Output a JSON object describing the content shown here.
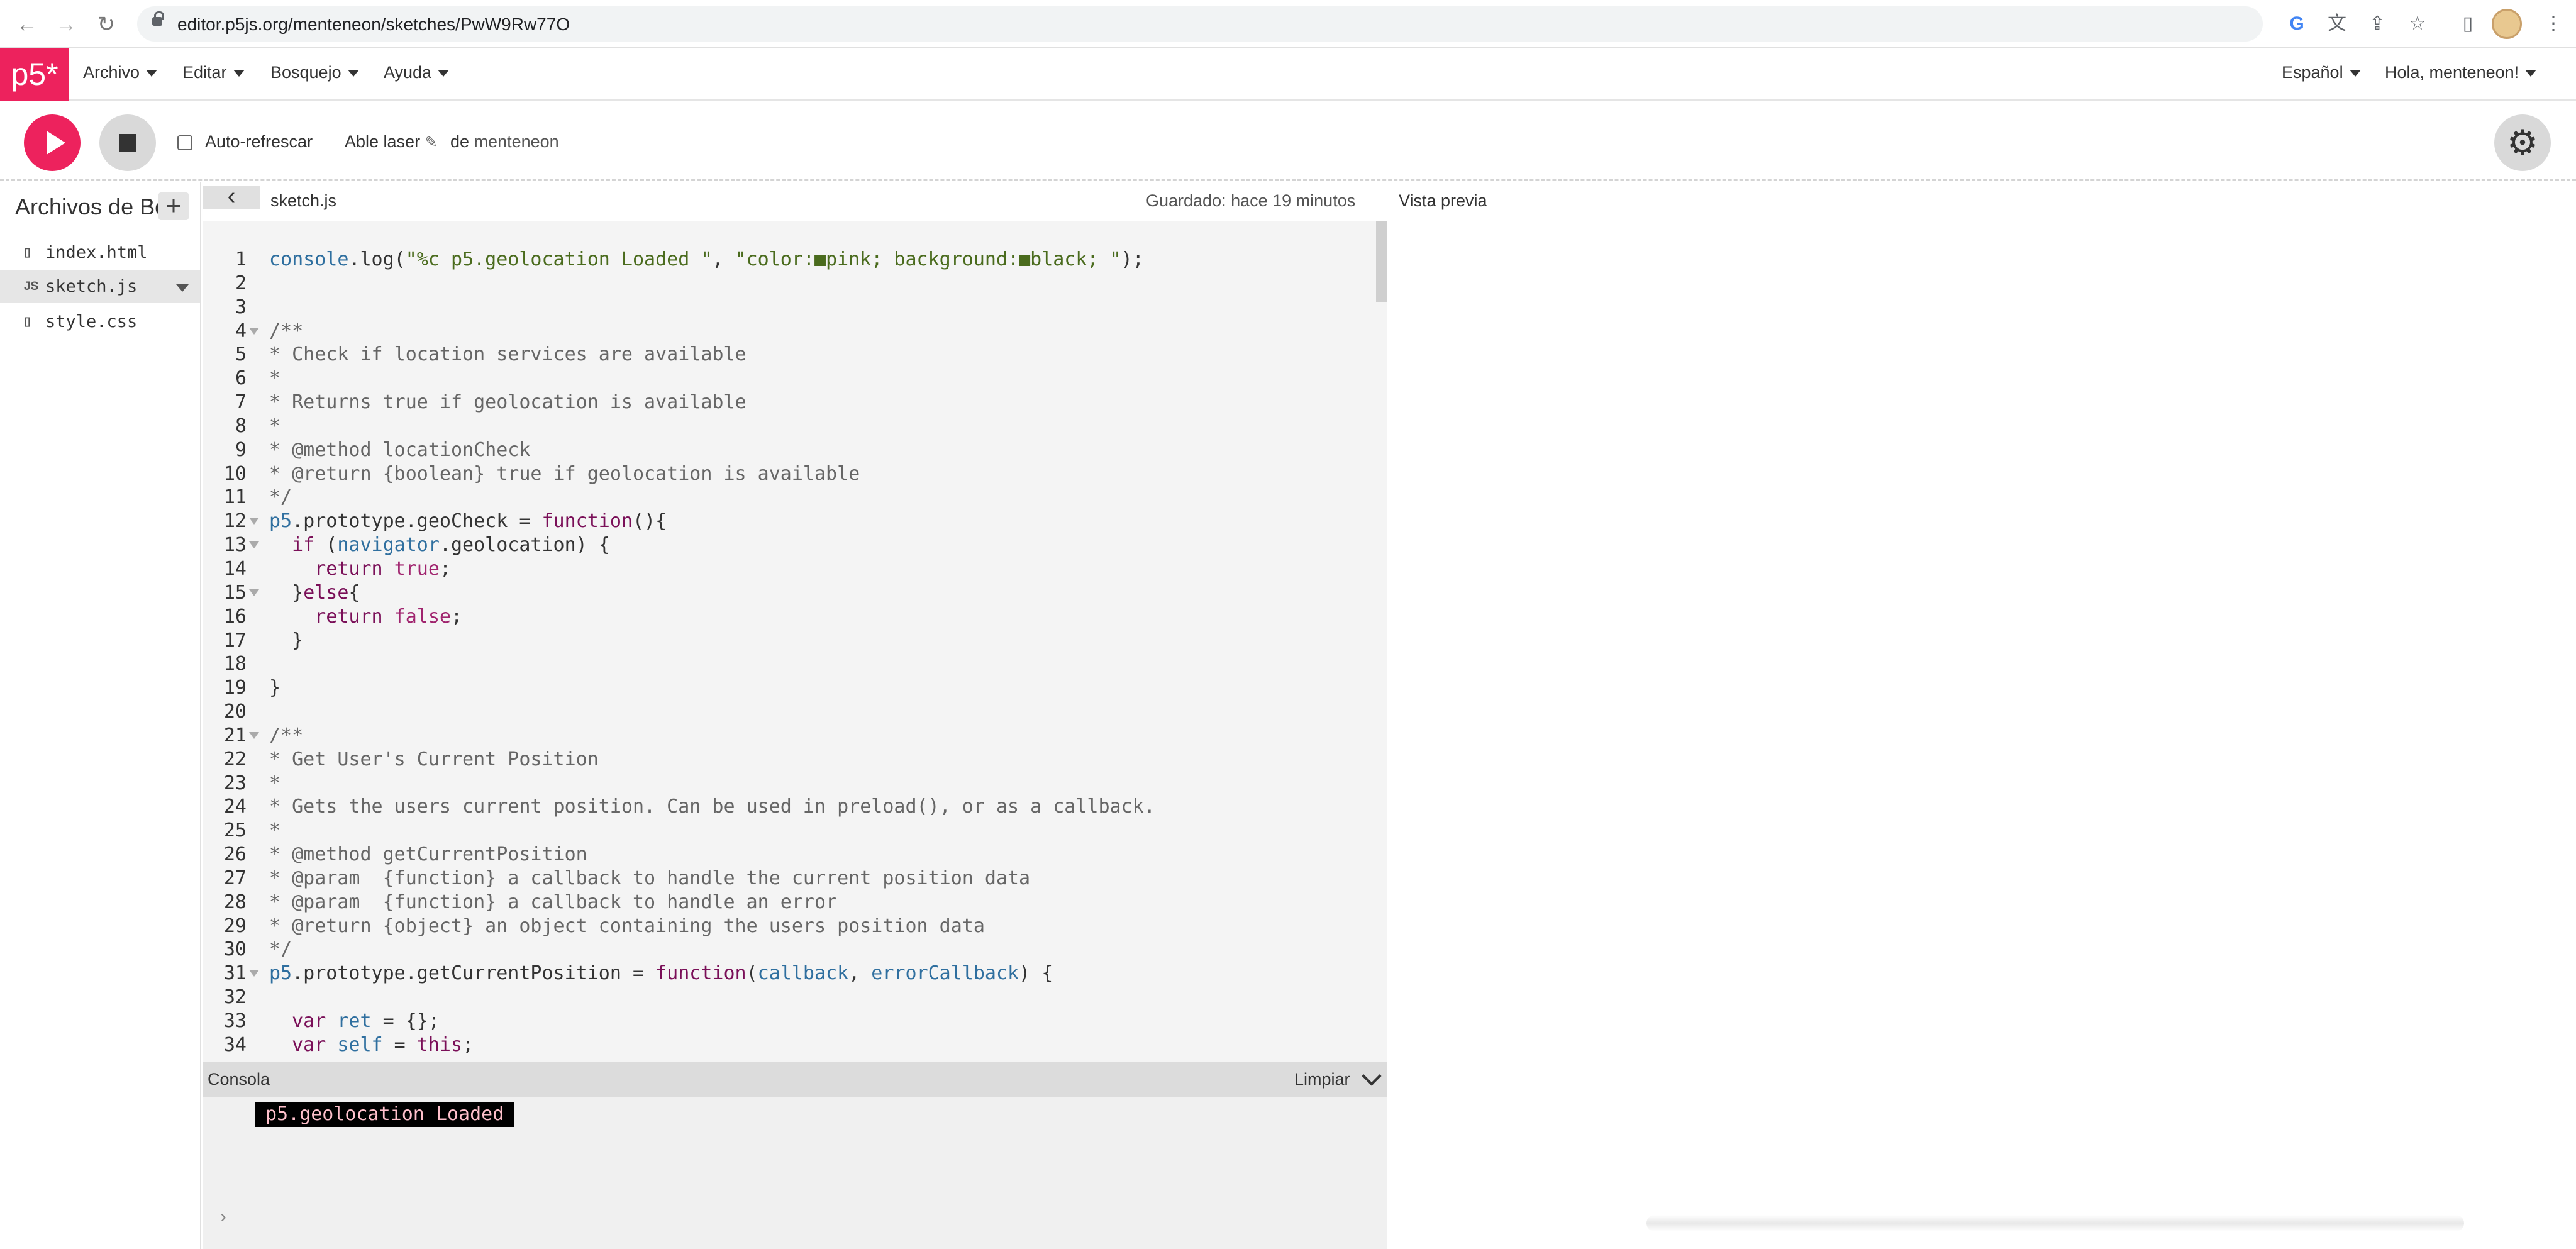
{
  "browser": {
    "url": "editor.p5js.org/menteneon/sketches/PwW9Rw77O",
    "nav_icons": [
      "back-icon",
      "forward-icon",
      "reload-icon"
    ],
    "toolbar_icons": [
      "google-icon",
      "translate-icon",
      "share-icon",
      "star-icon",
      "sidepanel-icon",
      "avatar",
      "menu-icon"
    ]
  },
  "p5nav": {
    "logo": "p5*",
    "menus": [
      "Archivo",
      "Editar",
      "Bosquejo",
      "Ayuda"
    ],
    "language": "Español",
    "greeting": "Hola, menteneon!"
  },
  "toolbar": {
    "autorefresh_label": "Auto-refrescar",
    "autorefresh_checked": false,
    "sketch_name": "Able laser",
    "author_prefix": "de",
    "author": "menteneon"
  },
  "sidebar": {
    "title": "Archivos de Bosquejo",
    "files": [
      {
        "icon": "file-icon",
        "name": "index.html",
        "selected": false
      },
      {
        "icon": "js-icon",
        "name": "sketch.js",
        "selected": true
      },
      {
        "icon": "file-icon",
        "name": "style.css",
        "selected": false
      }
    ]
  },
  "editor": {
    "tab": "sketch.js",
    "saved": "Guardado: hace 19 minutos",
    "preview_label": "Vista previa",
    "lines": [
      "console.log(\"%c p5.geolocation Loaded \", \"color:■pink; background:■black; \");",
      "",
      "",
      "/**",
      "* Check if location services are available",
      "*",
      "* Returns true if geolocation is available",
      "*",
      "* @method locationCheck",
      "* @return {boolean} true if geolocation is available",
      "*/",
      "p5.prototype.geoCheck = function(){",
      "  if (navigator.geolocation) {",
      "    return true;",
      "  }else{",
      "    return false;",
      "  }",
      "",
      "}",
      "",
      "/**",
      "* Get User's Current Position",
      "*",
      "* Gets the users current position. Can be used in preload(), or as a callback.",
      "*",
      "* @method getCurrentPosition",
      "* @param  {function} a callback to handle the current position data",
      "* @param  {function} a callback to handle an error",
      "* @return {object} an object containing the users position data",
      "*/",
      "p5.prototype.getCurrentPosition = function(callback, errorCallback) {",
      "",
      "  var ret = {};",
      "  var self = this;"
    ],
    "fold_lines": [
      4,
      12,
      13,
      15,
      21,
      31
    ]
  },
  "console": {
    "title": "Consola",
    "clear_label": "Limpiar",
    "message": "p5.geolocation Loaded",
    "prompt": "›"
  },
  "colors": {
    "p5_pink": "#ED225D",
    "code_keyword": "#7A0F58",
    "code_string": "#4A6B1D",
    "code_builtin": "#2F6F9F",
    "code_default": "#333333"
  }
}
